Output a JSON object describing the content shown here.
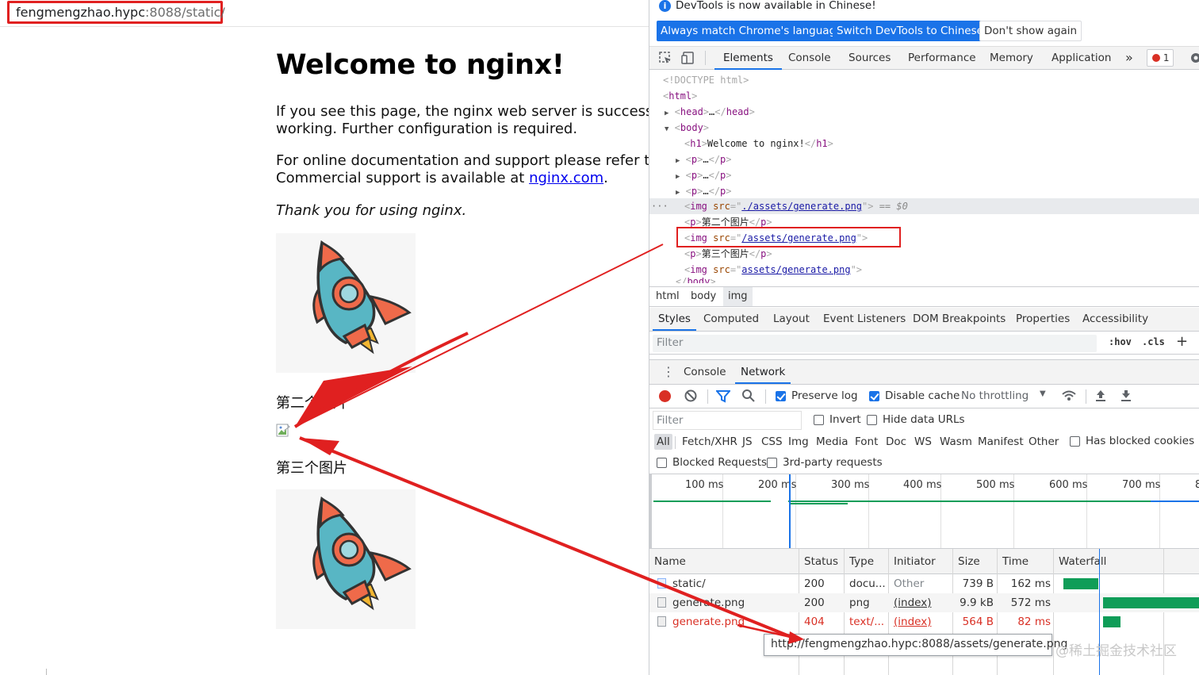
{
  "address_bar": {
    "host": "fengmengzhao.hypc",
    "rest": ":8088/static/"
  },
  "page": {
    "title": "Welcome to nginx!",
    "p1_line1": "If you see this page, the nginx web server is successfully i",
    "p1_line2": "working. Further configuration is required.",
    "p2_line1_text": "For online documentation and support please refer to ",
    "p2_line1_link": "ngin",
    "p2_line2_text": "Commercial support is available at ",
    "p2_line2_link": "nginx.com",
    "p2_line2_end": ".",
    "p3": "Thank you for using nginx.",
    "label2": "第二个图片",
    "label3": "第三个图片"
  },
  "devtools": {
    "notice": "DevTools is now available in Chinese!",
    "btn_match": "Always match Chrome's language",
    "btn_switch": "Switch DevTools to Chinese",
    "btn_dont": "Don't show again",
    "tabs": [
      "Elements",
      "Console",
      "Sources",
      "Performance",
      "Memory",
      "Application"
    ],
    "more": "»",
    "error_count": "1",
    "elements": {
      "doctype": "<!DOCTYPE html>",
      "html": "html",
      "head": "head",
      "body": "body",
      "h1": "h1",
      "h1_text": "Welcome to nginx!",
      "p": "p",
      "img": "img",
      "src": "src",
      "src1": "./assets/generate.png",
      "src2": "/assets/generate.png",
      "src3": "assets/generate.png",
      "dollar": "== $0",
      "p_text2": "第二个图片",
      "p_text3": "第三个图片",
      "ellipsis": "…",
      "gutter_dots": "···"
    },
    "breadcrumbs": [
      "html",
      "body",
      "img"
    ],
    "subtabs": [
      "Styles",
      "Computed",
      "Layout",
      "Event Listeners",
      "DOM Breakpoints",
      "Properties",
      "Accessibility"
    ],
    "styles_filter_placeholder": "Filter",
    "hov": ":hov",
    "cls": ".cls",
    "plus": "+",
    "drawer_tabs": [
      "Console",
      "Network"
    ],
    "preserve_log": "Preserve log",
    "disable_cache": "Disable cache",
    "throttling": "No throttling",
    "net_filter_placeholder": "Filter",
    "invert": "Invert",
    "hide_data_urls": "Hide data URLs",
    "types": [
      "All",
      "Fetch/XHR",
      "JS",
      "CSS",
      "Img",
      "Media",
      "Font",
      "Doc",
      "WS",
      "Wasm",
      "Manifest",
      "Other"
    ],
    "has_blocked_cookies": "Has blocked cookies",
    "blocked_requests": "Blocked Requests",
    "third_party": "3rd-party requests",
    "timeline_ticks": [
      "100 ms",
      "200 ms",
      "300 ms",
      "400 ms",
      "500 ms",
      "600 ms",
      "700 ms",
      "8"
    ],
    "columns": [
      "Name",
      "Status",
      "Type",
      "Initiator",
      "Size",
      "Time",
      "Waterfall"
    ],
    "rows": [
      {
        "name": "static/",
        "status": "200",
        "type": "docu...",
        "initiator": "Other",
        "size": "739 B",
        "time": "162 ms"
      },
      {
        "name": "generate.png",
        "status": "200",
        "type": "png",
        "initiator": "(index)",
        "size": "9.9 kB",
        "time": "572 ms"
      },
      {
        "name": "generate.png",
        "status": "404",
        "type": "text/...",
        "initiator": "(index)",
        "size": "564 B",
        "time": "82 ms"
      }
    ],
    "tooltip": "http://fengmengzhao.hypc:8088/assets/generate.png",
    "watermark": "@稀土掘金技术社区"
  },
  "colors": {
    "highlight": "#e02020",
    "accent": "#1a73e8",
    "link": "#0000ee",
    "waterfall": "#0f9d58",
    "error": "#d93025"
  }
}
